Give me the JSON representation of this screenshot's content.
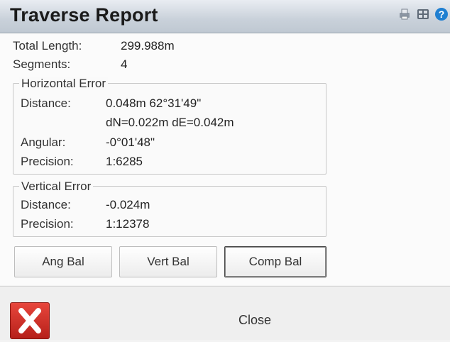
{
  "window": {
    "title": "Traverse Report",
    "icons": [
      "printer-icon",
      "grid-icon",
      "help-icon"
    ]
  },
  "summary": {
    "total_length_label": "Total Length:",
    "total_length_value": "299.988m",
    "segments_label": "Segments:",
    "segments_value": "4"
  },
  "horizontal_error": {
    "legend": "Horizontal Error",
    "distance_label": "Distance:",
    "distance_value": "0.048m 62°31'49\"",
    "distance_value_2": "dN=0.022m dE=0.042m",
    "angular_label": "Angular:",
    "angular_value": "-0°01'48\"",
    "precision_label": "Precision:",
    "precision_value": "1:6285"
  },
  "vertical_error": {
    "legend": "Vertical Error",
    "distance_label": "Distance:",
    "distance_value": "-0.024m",
    "precision_label": "Precision:",
    "precision_value": "1:12378"
  },
  "buttons": {
    "ang_bal": "Ang Bal",
    "vert_bal": "Vert Bal",
    "comp_bal": "Comp Bal"
  },
  "footer": {
    "close_label": "Close"
  },
  "colors": {
    "close_red": "#d0342c",
    "help_blue": "#1f7fd1"
  }
}
